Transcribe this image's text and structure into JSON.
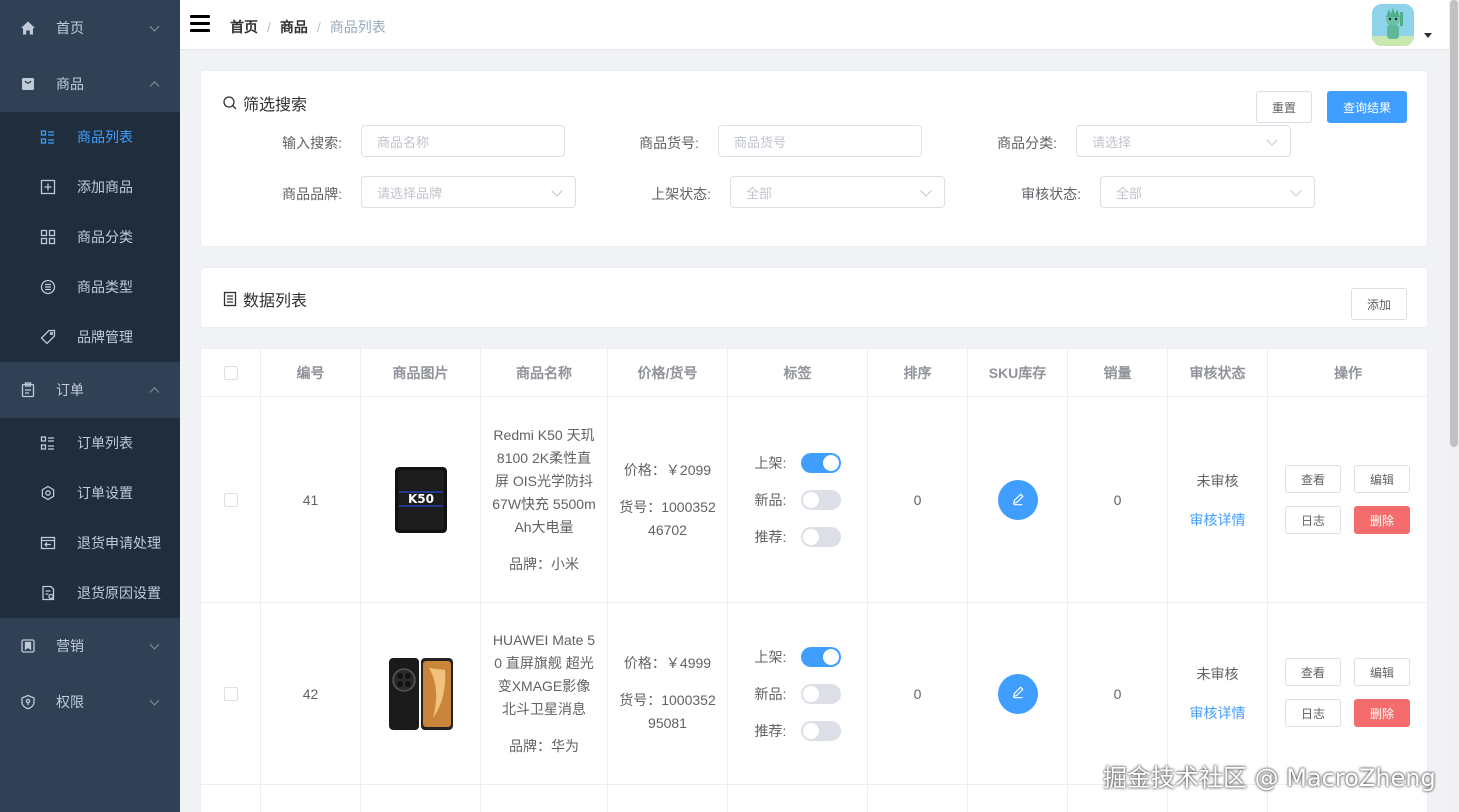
{
  "sidebar": {
    "groups": [
      {
        "label": "首页",
        "icon": "home-icon"
      },
      {
        "label": "商品",
        "icon": "shopping-bag-icon"
      },
      {
        "label": "订单",
        "icon": "clipboard-icon"
      },
      {
        "label": "营销",
        "icon": "bookmark-icon"
      },
      {
        "label": "权限",
        "icon": "shield-icon"
      }
    ],
    "product_items": [
      {
        "label": "商品列表",
        "icon": "list-icon",
        "active": true
      },
      {
        "label": "添加商品",
        "icon": "plus-square-icon"
      },
      {
        "label": "商品分类",
        "icon": "grid-icon"
      },
      {
        "label": "商品类型",
        "icon": "list-circle-icon"
      },
      {
        "label": "品牌管理",
        "icon": "tag-icon"
      }
    ],
    "order_items": [
      {
        "label": "订单列表",
        "icon": "list-icon"
      },
      {
        "label": "订单设置",
        "icon": "gear-icon"
      },
      {
        "label": "退货申请处理",
        "icon": "return-icon"
      },
      {
        "label": "退货原因设置",
        "icon": "document-icon"
      }
    ]
  },
  "navbar": {
    "breadcrumb": [
      "首页",
      "商品",
      "商品列表"
    ]
  },
  "filter": {
    "title": "筛选搜索",
    "reset_label": "重置",
    "query_label": "查询结果",
    "fields": [
      {
        "label": "输入搜索:",
        "placeholder": "商品名称"
      },
      {
        "label": "商品货号:",
        "placeholder": "商品货号"
      },
      {
        "label": "商品分类:",
        "placeholder": "请选择"
      },
      {
        "label": "商品品牌:",
        "placeholder": "请选择品牌"
      },
      {
        "label": "上架状态:",
        "placeholder": "全部"
      },
      {
        "label": "审核状态:",
        "placeholder": "全部"
      }
    ]
  },
  "list": {
    "title": "数据列表",
    "add_label": "添加"
  },
  "table": {
    "headers": [
      "编号",
      "商品图片",
      "商品名称",
      "价格/货号",
      "标签",
      "排序",
      "SKU库存",
      "销量",
      "审核状态",
      "操作"
    ],
    "tag_labels": [
      "上架:",
      "新品:",
      "推荐:"
    ],
    "rows": [
      {
        "id": "41",
        "name_lines": [
          "Redmi K50 天玑",
          "8100 2K柔性直",
          "屏 OIS光学防抖",
          "67W快充 5500m",
          "Ah大电量"
        ],
        "brand": "品牌：小米",
        "price": "价格：￥2099",
        "sku_lines": [
          "货号：1000352",
          "46702"
        ],
        "tags": {
          "publish": true,
          "new": false,
          "recommend": false
        },
        "sort": "0",
        "sales": "0",
        "verify": "未审核",
        "verify_link": "审核详情",
        "ops": [
          "查看",
          "编辑",
          "日志",
          "删除"
        ]
      },
      {
        "id": "42",
        "name_lines": [
          "HUAWEI Mate 5",
          "0 直屏旗舰 超光",
          "变XMAGE影像",
          "北斗卫星消息"
        ],
        "brand": "品牌：华为",
        "price": "价格：￥4999",
        "sku_lines": [
          "货号：1000352",
          "95081"
        ],
        "tags": {
          "publish": true,
          "new": false,
          "recommend": false
        },
        "sort": "0",
        "sales": "0",
        "verify": "未审核",
        "verify_link": "审核详情",
        "ops": [
          "查看",
          "编辑",
          "日志",
          "删除"
        ]
      }
    ]
  },
  "watermark": "掘金技术社区 @ MacroZheng",
  "colors": {
    "sidebar_bg": "#304156",
    "submenu_bg": "#1f2d3d",
    "accent": "#409eff",
    "danger": "#f56c6c"
  }
}
